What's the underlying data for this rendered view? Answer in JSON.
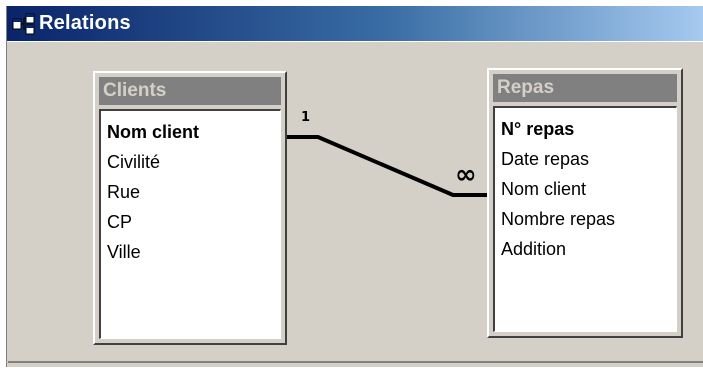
{
  "window": {
    "title": "Relations"
  },
  "tables": [
    {
      "name": "Clients",
      "fields": [
        {
          "label": "Nom client",
          "primary_key": true
        },
        {
          "label": "Civilité",
          "primary_key": false
        },
        {
          "label": "Rue",
          "primary_key": false
        },
        {
          "label": "CP",
          "primary_key": false
        },
        {
          "label": "Ville",
          "primary_key": false
        }
      ]
    },
    {
      "name": "Repas",
      "fields": [
        {
          "label": "N° repas",
          "primary_key": true
        },
        {
          "label": "Date repas",
          "primary_key": false
        },
        {
          "label": "Nom client",
          "primary_key": false
        },
        {
          "label": "Nombre repas",
          "primary_key": false
        },
        {
          "label": "Addition",
          "primary_key": false
        }
      ]
    }
  ],
  "relationship": {
    "from_table": "Clients",
    "from_field": "Nom client",
    "to_table": "Repas",
    "to_field": "Nom client",
    "one_side_label": "1",
    "many_side_label": "∞"
  },
  "colors": {
    "title_bar_start": "#0a246a",
    "title_bar_end": "#a6caf0",
    "workspace": "#d4d0c8",
    "table_header": "#808080"
  },
  "icons": {
    "title": "relationships-icon"
  }
}
